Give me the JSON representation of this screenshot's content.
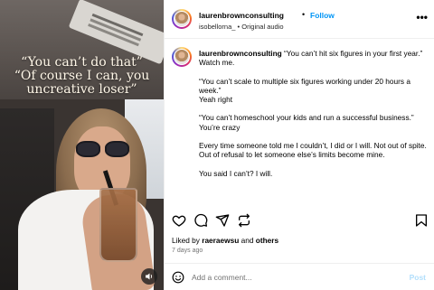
{
  "media": {
    "caption_lines": [
      "“You can’t do that”",
      "“Of course I can, you",
      "uncreative loser”"
    ],
    "audio_icon": "speaker-icon"
  },
  "header": {
    "username": "laurenbrownconsulting",
    "separator": "•",
    "follow_label": "Follow",
    "audio_user": "isobellorna_",
    "audio_separator": "•",
    "audio_label": "Original audio",
    "more_label": "•••"
  },
  "caption": {
    "username": "laurenbrownconsulting",
    "paragraphs": [
      "“You can’t hit six figures in your first year.”",
      "Watch me.",
      "“You can’t scale to multiple six figures working under 20 hours a week.”",
      "Yeah right",
      "“You can’t homeschool your kids and run a successful business.”",
      "You’re crazy",
      "Every time someone told me I couldn’t, I did or I will. Not out of spite. Out of refusal to let someone else’s limits become mine.",
      "You said I can’t? I will."
    ]
  },
  "actions": {
    "icons": [
      "heart-icon",
      "comment-icon",
      "share-icon",
      "bookmark-icon"
    ]
  },
  "likes": {
    "prefix": "Liked by",
    "user": "raeraewsu",
    "middle": "and",
    "others": "others"
  },
  "timestamp": "7 days ago",
  "add_comment": {
    "placeholder": "Add a comment...",
    "post_label": "Post"
  },
  "colors": {
    "accent": "#0095f6",
    "post_disabled": "#b2dffc",
    "muted": "#737373"
  }
}
